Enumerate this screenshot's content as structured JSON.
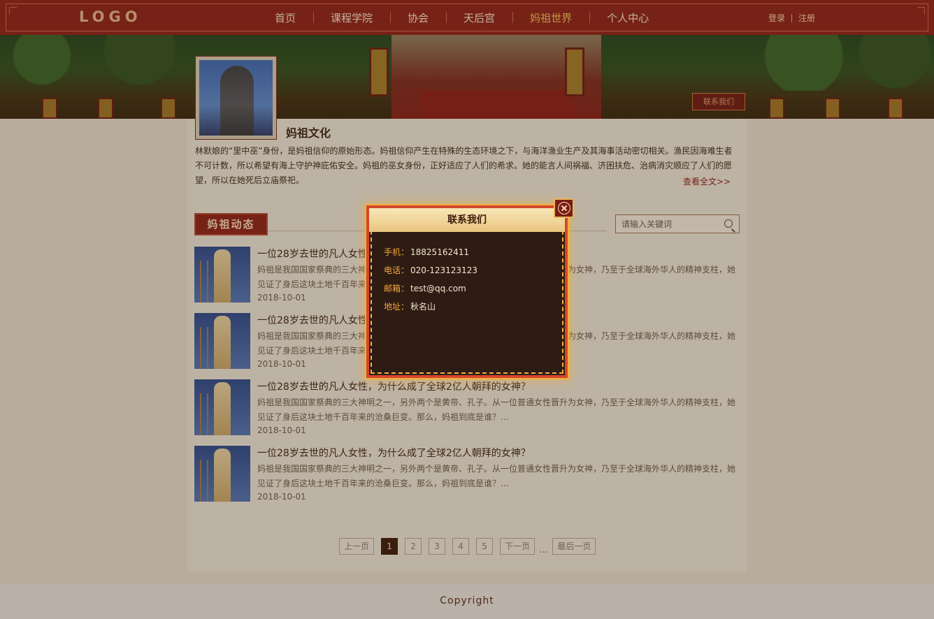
{
  "header": {
    "logo": "LOGO",
    "nav": [
      {
        "label": "首页",
        "active": false
      },
      {
        "label": "课程学院",
        "active": false
      },
      {
        "label": "协会",
        "active": false
      },
      {
        "label": "天后宫",
        "active": false
      },
      {
        "label": "妈祖世界",
        "active": true
      },
      {
        "label": "个人中心",
        "active": false
      }
    ],
    "login": "登录",
    "register": "注册"
  },
  "banner": {
    "contact_button": "联系我们"
  },
  "culture": {
    "title": "妈祖文化",
    "text": "林默娘的“里中巫”身份，是妈祖信仰的原始形态。妈祖信仰产生在特殊的生态环境之下，与海洋渔业生产及其海事活动密切相关。渔民因海难生者不可计数，所以希望有海上守护神庇佑安全。妈祖的巫女身份，正好适应了人们的希求。她的能言人间祸福、济困扶危、治病消灾顺应了人们的愿望，所以在她死后立庙祭祀。",
    "read_more": "查看全文>>"
  },
  "news": {
    "heading": "妈祖动态",
    "search_placeholder": "请输入关键词",
    "items": [
      {
        "title": "一位28岁去世的凡人女性，为什么成了全球2亿人朝拜的女神？",
        "desc": "妈祖是我国国家祭典的三大神明之一，另外两个是黄帝、孔子。从一位普通女性晋升为女神，乃至于全球海外华人的精神支柱，她见证了身后这块土地千百年来的沧桑巨变。那么，妈祖到底是谁？...",
        "date": "2018-10-01"
      },
      {
        "title": "一位28岁去世的凡人女性，为什么成了全球2亿人朝拜的女神？",
        "desc": "妈祖是我国国家祭典的三大神明之一，另外两个是黄帝、孔子。从一位普通女性晋升为女神，乃至于全球海外华人的精神支柱，她见证了身后这块土地千百年来的沧桑巨变。那么，妈祖到底是谁？...",
        "date": "2018-10-01"
      },
      {
        "title": "一位28岁去世的凡人女性，为什么成了全球2亿人朝拜的女神？",
        "desc": "妈祖是我国国家祭典的三大神明之一，另外两个是黄帝、孔子。从一位普通女性晋升为女神，乃至于全球海外华人的精神支柱，她见证了身后这块土地千百年来的沧桑巨变。那么，妈祖到底是谁？...",
        "date": "2018-10-01"
      },
      {
        "title": "一位28岁去世的凡人女性，为什么成了全球2亿人朝拜的女神？",
        "desc": "妈祖是我国国家祭典的三大神明之一，另外两个是黄帝、孔子。从一位普通女性晋升为女神，乃至于全球海外华人的精神支柱，她见证了身后这块土地千百年来的沧桑巨变。那么，妈祖到底是谁？...",
        "date": "2018-10-01"
      }
    ]
  },
  "pagination": {
    "prev": "上一页",
    "pages": [
      "1",
      "2",
      "3",
      "4",
      "5"
    ],
    "current": "1",
    "next": "下一页",
    "ellipsis": "...",
    "last": "最后一页"
  },
  "footer": {
    "copyright": "Copyright"
  },
  "modal": {
    "title": "联系我们",
    "rows": [
      {
        "label": "手机：",
        "value": "18825162411"
      },
      {
        "label": "电话：",
        "value": "020-123123123"
      },
      {
        "label": "邮箱：",
        "value": "test@qq.com"
      },
      {
        "label": "地址：",
        "value": "秋名山"
      }
    ]
  },
  "colors": {
    "brand_red": "#8e2018",
    "nav_active": "#f3c25a",
    "modal_border": "#d4472d",
    "modal_bg": "#2e1c14"
  }
}
